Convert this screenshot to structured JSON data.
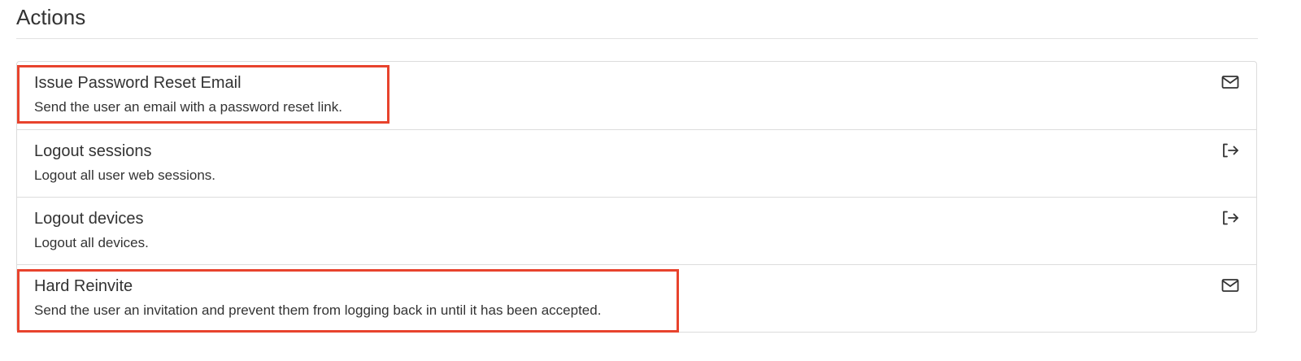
{
  "section": {
    "title": "Actions"
  },
  "actions": [
    {
      "title": "Issue Password Reset Email",
      "description": "Send the user an email with a password reset link.",
      "icon": "envelope-icon",
      "highlighted": true
    },
    {
      "title": "Logout sessions",
      "description": "Logout all user web sessions.",
      "icon": "sign-out-icon",
      "highlighted": false
    },
    {
      "title": "Logout devices",
      "description": "Logout all devices.",
      "icon": "sign-out-icon",
      "highlighted": false
    },
    {
      "title": "Hard Reinvite",
      "description": "Send the user an invitation and prevent them from logging back in until it has been accepted.",
      "icon": "envelope-icon",
      "highlighted": true
    }
  ],
  "colors": {
    "highlight": "#e8432d",
    "border": "#dcdcdc",
    "text": "#333333"
  }
}
